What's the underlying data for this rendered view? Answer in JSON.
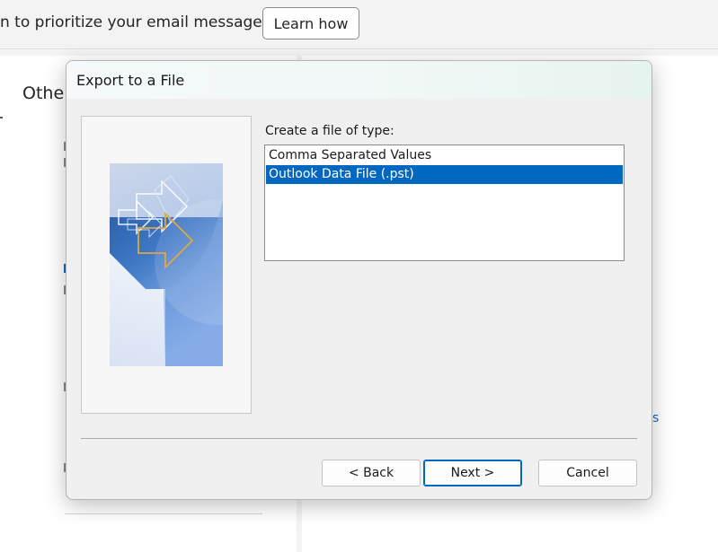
{
  "background": {
    "banner_text": "n to prioritize your email messages.",
    "learn_how_label": "Learn how",
    "other_heading": "Othe",
    "right_link_fragment": "s"
  },
  "dialog": {
    "title": "Export to a File",
    "list_label": "Create a file of type:",
    "file_types": [
      {
        "label": "Comma Separated Values",
        "selected": false
      },
      {
        "label": "Outlook Data File (.pst)",
        "selected": true
      }
    ],
    "buttons": {
      "back": "< Back",
      "next": "Next >",
      "cancel": "Cancel"
    }
  },
  "colors": {
    "selection": "#0067c0",
    "accent_link": "#0f6cbd",
    "dialog_bg": "#f0f0f0"
  },
  "icons": {
    "wizard_art": "export-wizard-arrows-image"
  }
}
